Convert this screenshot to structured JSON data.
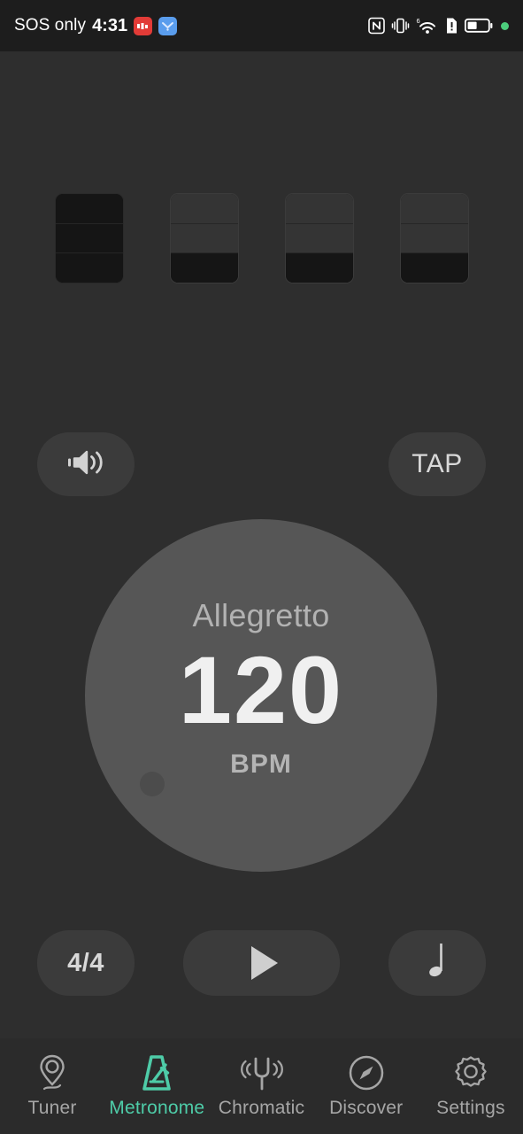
{
  "status_bar": {
    "carrier": "SOS only",
    "time": "4:31",
    "notification_icons": [
      {
        "name": "red-app-notification-icon",
        "color": "#e23b37"
      },
      {
        "name": "blue-app-notification-icon",
        "color": "#5a9ded"
      }
    ],
    "system_icons": [
      {
        "name": "nfc-icon"
      },
      {
        "name": "vibrate-icon"
      },
      {
        "name": "wifi-6-icon",
        "label": "6"
      },
      {
        "name": "sim-alert-icon"
      },
      {
        "name": "battery-icon"
      },
      {
        "name": "green-status-dot-icon",
        "color": "#4ccd7c"
      }
    ]
  },
  "beat_pattern": {
    "beats": [
      {
        "index": 1,
        "accent": true,
        "segments": [
          "on",
          "on",
          "on"
        ]
      },
      {
        "index": 2,
        "accent": false,
        "segments": [
          "off",
          "off",
          "on"
        ]
      },
      {
        "index": 3,
        "accent": false,
        "segments": [
          "off",
          "off",
          "on"
        ]
      },
      {
        "index": 4,
        "accent": false,
        "segments": [
          "off",
          "off",
          "on"
        ]
      }
    ]
  },
  "top_controls": {
    "volume_icon": "speaker-volume-icon",
    "tap_label": "TAP"
  },
  "dial": {
    "tempo_name": "Allegretto",
    "bpm": "120",
    "unit": "BPM",
    "knob_icon": "dial-knob-handle"
  },
  "bottom_controls": {
    "time_signature": "4/4",
    "play_icon": "play-icon",
    "note_value_icon": "quarter-note-icon"
  },
  "nav": {
    "items": [
      {
        "label": "Tuner",
        "icon": "tuning-peg-icon",
        "active": false
      },
      {
        "label": "Metronome",
        "icon": "metronome-icon",
        "active": true
      },
      {
        "label": "Chromatic",
        "icon": "tuning-fork-icon",
        "active": false
      },
      {
        "label": "Discover",
        "icon": "compass-icon",
        "active": false
      },
      {
        "label": "Settings",
        "icon": "gear-icon",
        "active": false
      }
    ]
  },
  "colors": {
    "background": "#2e2e2e",
    "statusbar_bg": "#1d1d1d",
    "pill": "#3b3b3b",
    "dial": "#565656",
    "accent": "#4ecca8",
    "text_primary": "#f0f0f0",
    "text_secondary": "#b2b2b2"
  }
}
